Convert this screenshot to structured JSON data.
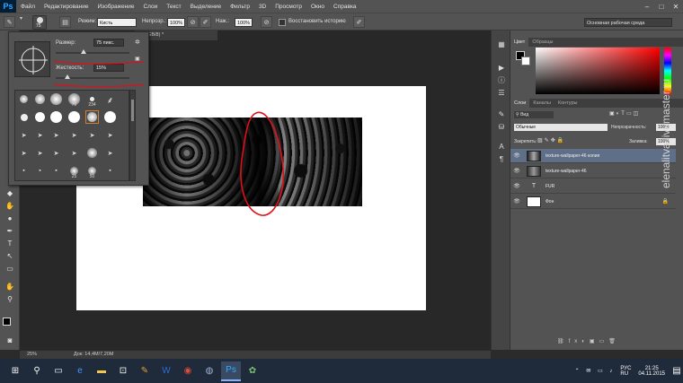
{
  "app": {
    "logo": "Ps"
  },
  "menu": [
    "Файл",
    "Редактирование",
    "Изображение",
    "Слои",
    "Текст",
    "Выделение",
    "Фильтр",
    "3D",
    "Просмотр",
    "Окно",
    "Справка"
  ],
  "window_controls": {
    "minimize": "–",
    "maximize": "□",
    "close": "✕"
  },
  "options_bar": {
    "brush_size": "75",
    "mode_label": "Режим:",
    "mode_value": "Кисть",
    "opacity_label": "Непрозр.:",
    "opacity_value": "100%",
    "pressure_label": "Наж.:",
    "pressure_value": "100%",
    "history_label": "Восстановить историю",
    "workspace": "Основная рабочая среда"
  },
  "document": {
    "tab_title": "a, RGB/8) *",
    "zoom": "25%",
    "doc_size": "Док: 14,4M/7,20M"
  },
  "brush_panel": {
    "size_label": "Размер:",
    "size_value": "75 пикс.",
    "hardness_label": "Жесткость:",
    "hardness_value": "15%",
    "preset_labels": [
      "75",
      "234",
      "25",
      "50"
    ]
  },
  "color_panel": {
    "tab_color": "Цвет",
    "tab_swatches": "Образцы"
  },
  "layers_panel": {
    "tabs": [
      "Слои",
      "Каналы",
      "Контуры"
    ],
    "filter_value": "Вид",
    "blend_mode": "Обычные",
    "opacity_label": "Непрозрачность:",
    "opacity_value": "100%",
    "lock_label": "Закрепить:",
    "fill_label": "Заливка:",
    "fill_value": "100%",
    "layers": [
      {
        "name": "texture-wallpaper-46 копия",
        "selected": true
      },
      {
        "name": "texture-wallpaper-46",
        "selected": false
      },
      {
        "name": "FUR",
        "selected": false
      },
      {
        "name": "Фон",
        "selected": false
      }
    ]
  },
  "watermark": "elenalitva.livemaster.ru",
  "taskbar": {
    "lang": "РУС",
    "lang2": "RU",
    "time": "21:25",
    "date": "04.11.2015"
  },
  "colors": {
    "annotation": "#e0101a",
    "selection": "#5f6f87"
  }
}
